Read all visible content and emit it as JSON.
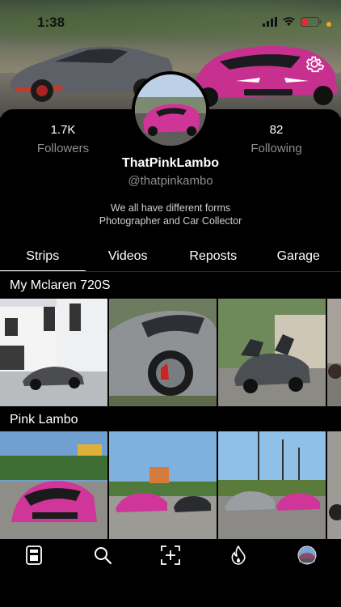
{
  "status_bar": {
    "time": "1:38"
  },
  "profile": {
    "followers_count": "1.7K",
    "followers_label": "Followers",
    "following_count": "82",
    "following_label": "Following",
    "display_name": "ThatPinkLambo",
    "handle": "@thatpinkambo",
    "bio_line1": "We all have different forms",
    "bio_line2": "Photographer and Car Collector"
  },
  "tabs": [
    {
      "label": "Strips",
      "active": true
    },
    {
      "label": "Videos",
      "active": false
    },
    {
      "label": "Reposts",
      "active": false
    },
    {
      "label": "Garage",
      "active": false
    }
  ],
  "strips": [
    {
      "title": "My Mclaren 720S"
    },
    {
      "title": "Pink Lambo"
    }
  ],
  "icons": {
    "settings": "gear-icon",
    "nav": [
      "feed-icon",
      "search-icon",
      "create-icon",
      "fire-icon",
      "profile-avatar"
    ]
  },
  "colors": {
    "accent_pink": "#d63c9a",
    "muted_text": "#8e8e8e",
    "status_dot": "#f2a51a"
  }
}
